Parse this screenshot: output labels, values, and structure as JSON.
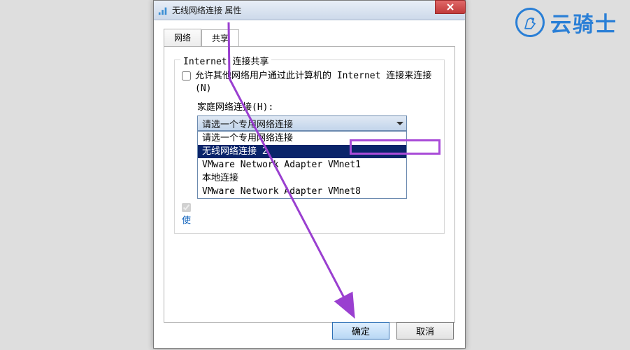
{
  "window": {
    "title": "无线网络连接 属性"
  },
  "tabs": {
    "network": "网络",
    "share": "共享"
  },
  "groupbox": {
    "title": "Internet 连接共享"
  },
  "checkbox1": {
    "label": "允许其他网络用户通过此计算机的 Internet 连接来连接(N)"
  },
  "homeNetwork": {
    "label": "家庭网络连接(H):"
  },
  "dropdown": {
    "selected": "请选一个专用网络连接"
  },
  "listItems": {
    "0": "请选一个专用网络连接",
    "1": "无线网络连接 2",
    "2": "VMware Network Adapter VMnet1",
    "3": "本地连接",
    "4": "VMware Network Adapter VMnet8"
  },
  "checkbox2": {
    "prefix": "使"
  },
  "buttons": {
    "ok": "确定",
    "cancel": "取消"
  },
  "logo": {
    "text": "云骑士"
  }
}
